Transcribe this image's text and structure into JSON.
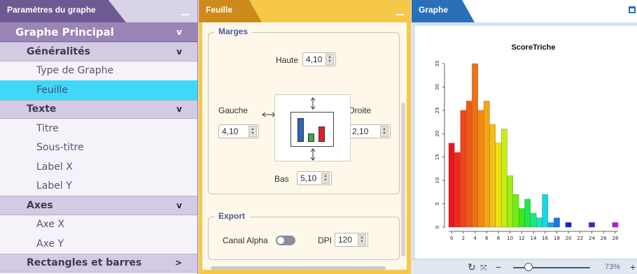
{
  "left_panel": {
    "title": "Paramètres du graphe",
    "sections": [
      {
        "label": "Graphe Principal",
        "kind": "main",
        "chevron": "v"
      },
      {
        "label": "Généralités",
        "kind": "section",
        "chevron": "v"
      },
      {
        "label": "Type de Graphe",
        "kind": "item"
      },
      {
        "label": "Feuille",
        "kind": "item",
        "selected": true
      },
      {
        "label": "Texte",
        "kind": "section",
        "chevron": "v"
      },
      {
        "label": "Titre",
        "kind": "item"
      },
      {
        "label": "Sous-titre",
        "kind": "item"
      },
      {
        "label": "Label X",
        "kind": "item"
      },
      {
        "label": "Label Y",
        "kind": "item"
      },
      {
        "label": "Axes",
        "kind": "section",
        "chevron": "v"
      },
      {
        "label": "Axe X",
        "kind": "item"
      },
      {
        "label": "Axe Y",
        "kind": "item"
      },
      {
        "label": "Rectangles et barres",
        "kind": "section",
        "chevron": ">"
      }
    ]
  },
  "middle_panel": {
    "title": "Feuille",
    "marges": {
      "legend": "Marges",
      "haute_label": "Haute",
      "haute_value": "4,10",
      "gauche_label": "Gauche",
      "gauche_value": "4,10",
      "droite_label": "Droite",
      "droite_value": "2,10",
      "bas_label": "Bas",
      "bas_value": "5,10"
    },
    "export": {
      "legend": "Export",
      "alpha_label": "Canal Alpha",
      "alpha_on": false,
      "dpi_label": "DPI",
      "dpi_value": "120"
    }
  },
  "right_panel": {
    "title": "Graphe",
    "zoom_text": "73%",
    "zoom_level": 0.2
  },
  "chart_data": {
    "type": "bar",
    "title": "ScoreTriche",
    "x": [
      0,
      1,
      2,
      3,
      4,
      5,
      6,
      7,
      8,
      9,
      10,
      11,
      12,
      13,
      14,
      15,
      16,
      17,
      18,
      19,
      20,
      21,
      22,
      23,
      24,
      25,
      26,
      27,
      28
    ],
    "values": [
      18,
      16,
      25,
      27,
      35,
      25,
      27,
      22,
      18,
      21,
      11,
      7,
      4,
      6,
      3,
      2,
      7,
      1,
      2,
      0,
      1,
      0,
      0,
      0,
      1,
      0,
      0,
      0,
      1
    ],
    "xticks": [
      "0",
      "2",
      "4",
      "6",
      "8",
      "10",
      "12",
      "14",
      "16",
      "18",
      "20",
      "22",
      "24",
      "26",
      "28"
    ],
    "yticks": [
      "0",
      "5",
      "10",
      "15",
      "20",
      "25",
      "30",
      "35"
    ],
    "ylim": [
      0,
      35
    ],
    "colors": [
      "#e8141e",
      "#ee2a1c",
      "#f0441a",
      "#f05a16",
      "#f27014",
      "#f48a12",
      "#f4a412",
      "#f4bf12",
      "#eedf10",
      "#c8ee10",
      "#9cee12",
      "#6eee14",
      "#3ee818",
      "#20e84c",
      "#18e880",
      "#16e6b2",
      "#14d8e6",
      "#14a8e8",
      "#1478e8",
      "#1448e8",
      "#1420e0",
      "#2014d8",
      "#3414d0",
      "#4a14cc",
      "#6014c8",
      "#7814c8",
      "#9014d0",
      "#a816d8",
      "#c018e0"
    ]
  }
}
